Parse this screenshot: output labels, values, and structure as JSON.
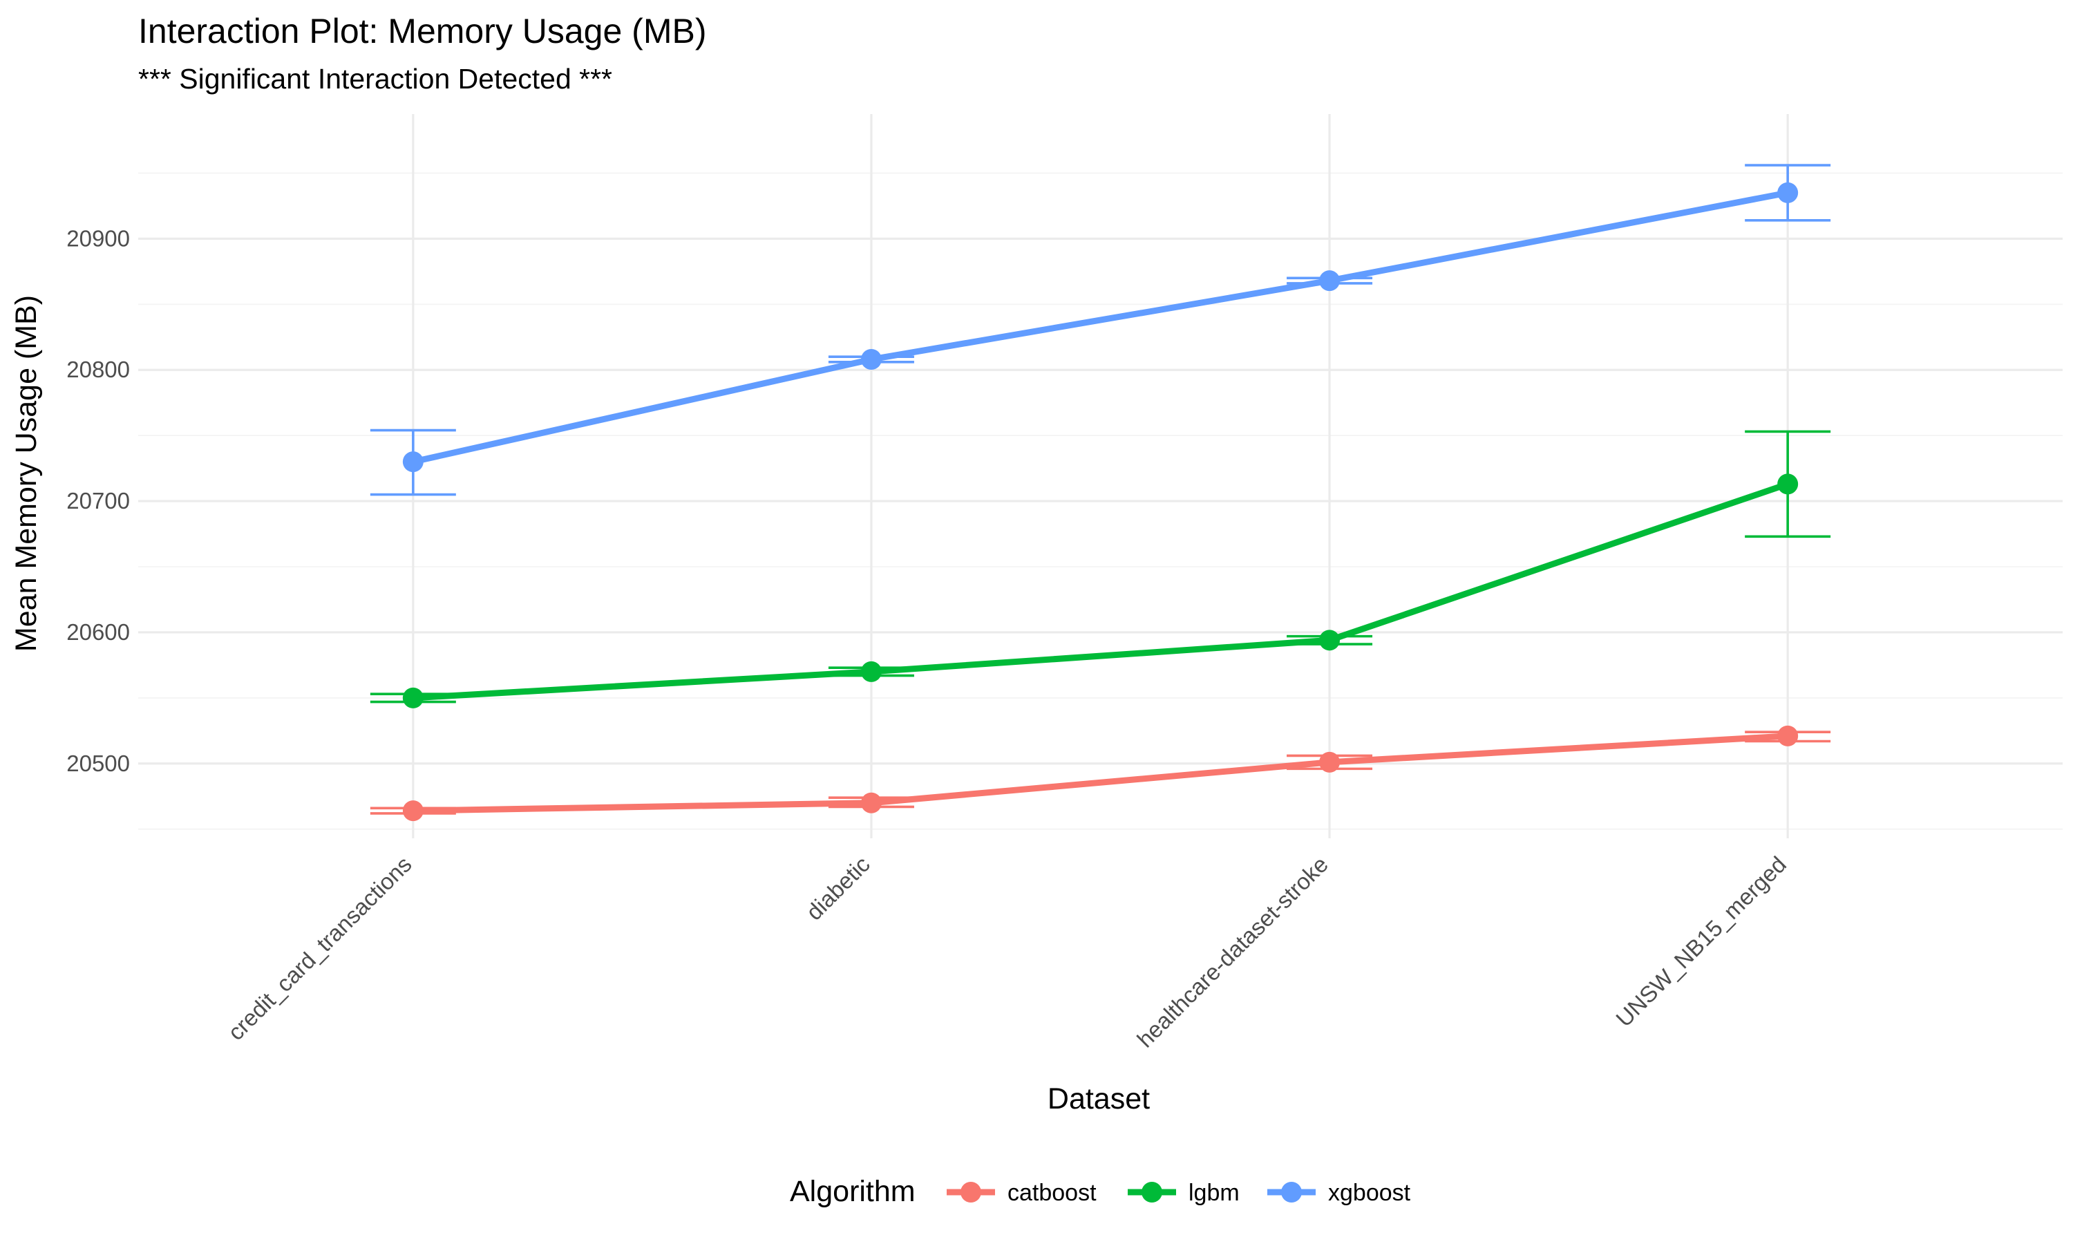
{
  "chart_data": {
    "type": "line",
    "title": "Interaction Plot: Memory Usage (MB)",
    "subtitle": "*** Significant Interaction Detected ***",
    "xlabel": "Dataset",
    "ylabel": "Mean Memory Usage (MB)",
    "categories": [
      "credit_card_transactions",
      "diabetic",
      "healthcare-dataset-stroke",
      "UNSW_NB15_merged"
    ],
    "ylim": [
      20443,
      20995
    ],
    "yticks": [
      20500,
      20600,
      20700,
      20800,
      20900
    ],
    "grid": true,
    "legend": {
      "title": "Algorithm",
      "position": "bottom"
    },
    "series": [
      {
        "name": "catboost",
        "color": "#F8766D",
        "values": [
          20464,
          20470,
          20501,
          20521
        ],
        "err_low": [
          20462,
          20467,
          20496,
          20517
        ],
        "err_high": [
          20466,
          20474,
          20506,
          20524
        ]
      },
      {
        "name": "lgbm",
        "color": "#00BA38",
        "values": [
          20550,
          20570,
          20594,
          20713
        ],
        "err_low": [
          20547,
          20567,
          20591,
          20673
        ],
        "err_high": [
          20553,
          20573,
          20597,
          20753
        ]
      },
      {
        "name": "xgboost",
        "color": "#619CFF",
        "values": [
          20730,
          20808,
          20868,
          20935
        ],
        "err_low": [
          20705,
          20806,
          20866,
          20914
        ],
        "err_high": [
          20754,
          20810,
          20870,
          20956
        ]
      }
    ]
  }
}
